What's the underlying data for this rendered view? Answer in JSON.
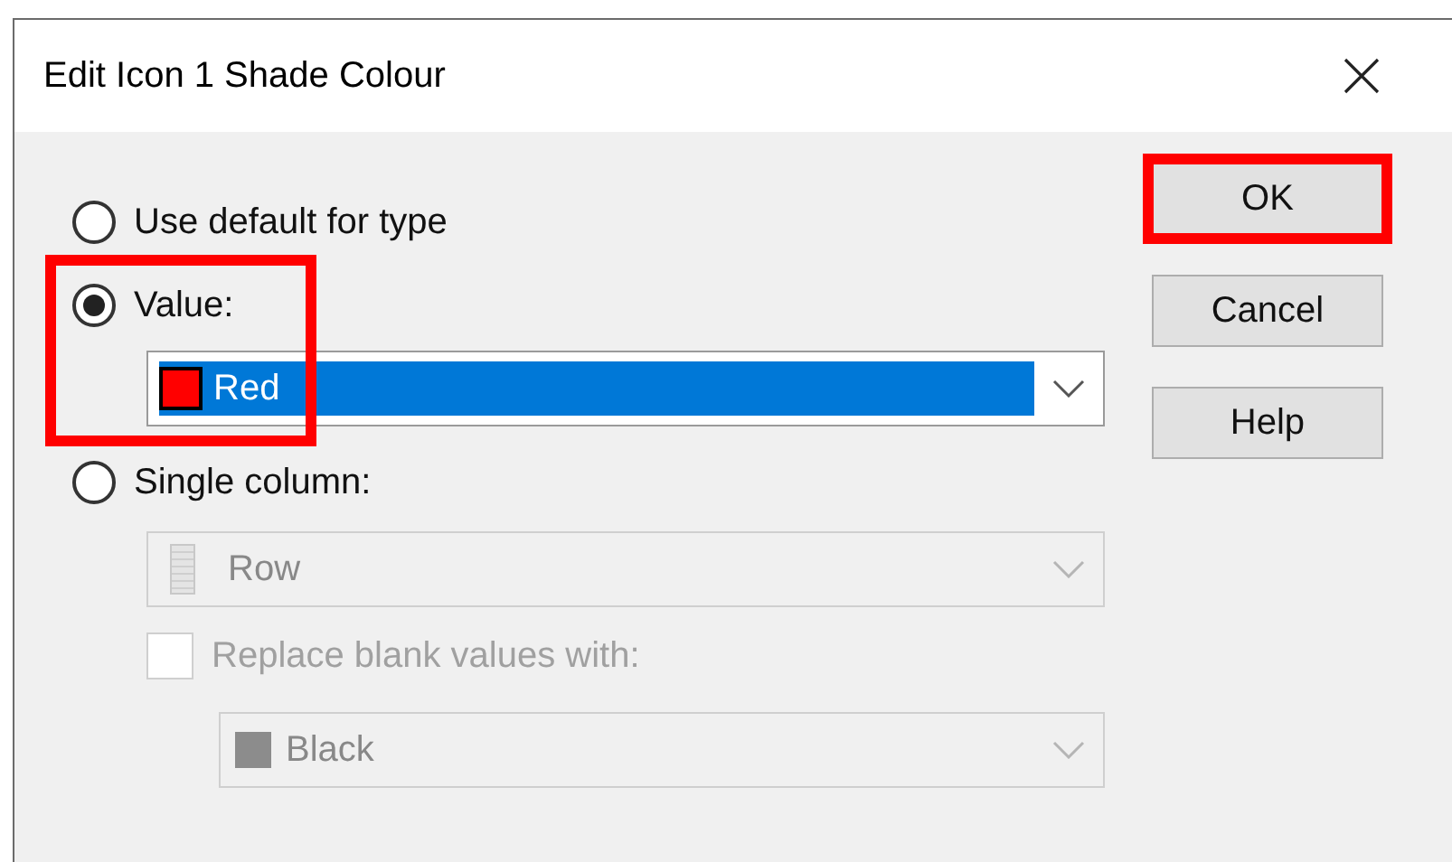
{
  "window": {
    "title": "Edit Icon 1 Shade Colour"
  },
  "options": [
    {
      "label": "Use default for type",
      "selected": false,
      "highlighted": false
    },
    {
      "label": "Value:",
      "selected": true,
      "highlighted": true,
      "dropdown": {
        "value": "Red",
        "color": "#ff0000",
        "disabled": false
      }
    },
    {
      "label": "Single column:",
      "selected": false,
      "highlighted": false,
      "dropdown": {
        "value": "Row",
        "disabled": true
      },
      "replace_blank": {
        "label": "Replace blank values with:",
        "checked": false,
        "disabled": true,
        "dropdown": {
          "value": "Black",
          "color": "#8c8c8c",
          "disabled": true
        }
      }
    }
  ],
  "buttons": [
    {
      "label": "OK",
      "highlighted": true
    },
    {
      "label": "Cancel",
      "highlighted": false
    },
    {
      "label": "Help",
      "highlighted": false
    }
  ]
}
